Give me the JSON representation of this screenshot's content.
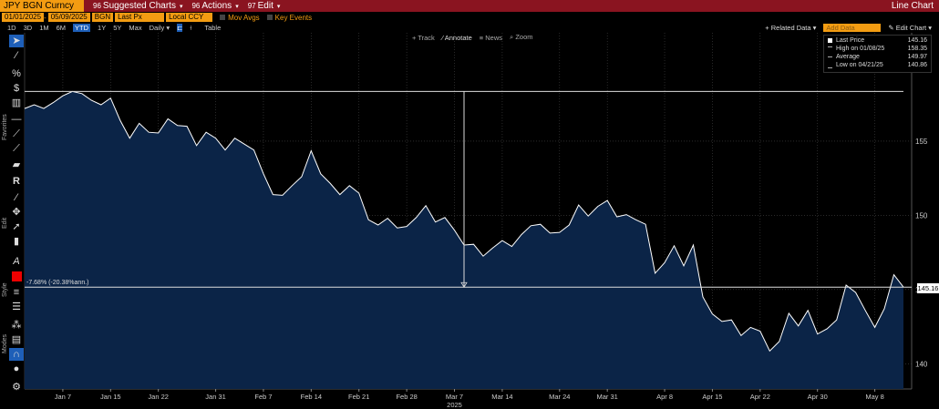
{
  "topbar": {
    "ticker": "JPY BGN Curncy",
    "menu_suggested": "Suggested Charts",
    "menu_actions": "Actions",
    "menu_edit": "Edit",
    "num_suggested": "96",
    "num_actions": "96",
    "num_edit": "97",
    "title": "Line Chart"
  },
  "settings": {
    "start_date": "01/01/2025",
    "end_date": "05/09/2025",
    "source": "BGN",
    "field": "Last Px",
    "currency": "Local CCY",
    "mov_avgs": "Mov Avgs",
    "key_events": "Key Events"
  },
  "periods": [
    "1D",
    "3D",
    "1M",
    "6M",
    "YTD",
    "1Y",
    "5Y",
    "Max"
  ],
  "frequency": "Daily",
  "table_label": "Table",
  "related_data": "Related Data",
  "add_data_placeholder": "Add Data",
  "edit_chart": "Edit Chart",
  "chart_tools": [
    "Track",
    "Annotate",
    "News",
    "Zoom"
  ],
  "sidebar_labels": [
    "Favorites",
    "Edit",
    "Style",
    "Modes"
  ],
  "legend": {
    "last_price_label": "Last Price",
    "last_price_value": "145.16",
    "high_label": "High on 01/08/25",
    "high_value": "158.35",
    "avg_label": "Average",
    "avg_value": "149.97",
    "low_label": "Low on 04/21/25",
    "low_value": "140.86"
  },
  "annotation_text": "-7.68% (-20.38%ann.)",
  "last_price_box": "145.16",
  "colors": {
    "accent": "#f39c12",
    "topbar": "#8a1420",
    "area": "#0b2447",
    "line": "#ffffff"
  },
  "chart_data": {
    "type": "area",
    "title": "",
    "ylim": [
      138.3,
      162.3
    ],
    "yticks": [
      140,
      145,
      150,
      155
    ],
    "xtick_labels": [
      "Jan 7",
      "Jan 15",
      "Jan 22",
      "Jan 31",
      "Feb 7",
      "Feb 14",
      "Feb 21",
      "Feb 28",
      "Mar 7",
      "Mar 14",
      "Mar 24",
      "Mar 31",
      "Apr 8",
      "Apr 15",
      "Apr 22",
      "Apr 30",
      "May 8"
    ],
    "xtick_indices": [
      4,
      9,
      14,
      20,
      25,
      30,
      35,
      40,
      45,
      50,
      56,
      61,
      67,
      72,
      77,
      83,
      89
    ],
    "year_label": "2025",
    "values": [
      157.2,
      157.45,
      157.2,
      157.6,
      158.05,
      158.35,
      158.2,
      157.75,
      157.45,
      157.9,
      156.4,
      155.2,
      156.2,
      155.6,
      155.55,
      156.5,
      156.05,
      156.0,
      154.7,
      155.6,
      155.2,
      154.4,
      155.2,
      154.8,
      154.4,
      152.8,
      151.4,
      151.35,
      152.0,
      152.6,
      154.35,
      152.8,
      152.15,
      151.4,
      152.0,
      151.5,
      149.7,
      149.35,
      149.8,
      149.15,
      149.25,
      149.85,
      150.65,
      149.55,
      149.85,
      149.0,
      148.0,
      148.05,
      147.25,
      147.8,
      148.3,
      147.9,
      148.7,
      149.3,
      149.4,
      148.8,
      148.85,
      149.35,
      150.7,
      149.95,
      150.6,
      151.0,
      149.9,
      150.05,
      149.7,
      149.4,
      146.1,
      146.8,
      147.95,
      146.6,
      148.0,
      144.5,
      143.35,
      142.85,
      142.95,
      141.9,
      142.45,
      142.2,
      140.86,
      141.5,
      143.4,
      142.55,
      143.6,
      142.0,
      142.35,
      142.95,
      145.3,
      144.8,
      143.6,
      142.45,
      143.7,
      146.0,
      145.16
    ],
    "reference_lines": {
      "high": 158.35,
      "last": 145.16
    },
    "annotation": {
      "from_index": 46,
      "from_value": 158.35,
      "to_value": 145.16
    }
  }
}
